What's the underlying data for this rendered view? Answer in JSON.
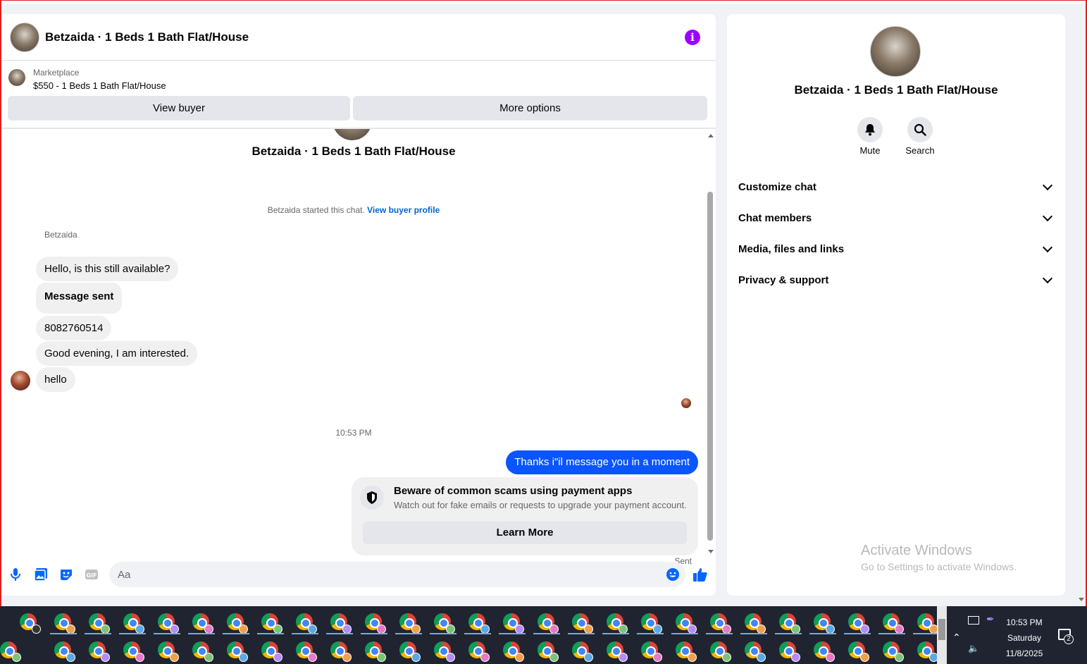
{
  "chat": {
    "header_title": "Betzaida · 1 Beds 1 Bath Flat/House",
    "marketplace_label": "Marketplace",
    "listing": "$550 - 1 Beds 1 Bath Flat/House",
    "view_buyer": "View buyer",
    "more_options": "More options",
    "thread_title": "Betzaida · 1 Beds 1 Bath Flat/House",
    "started_text": "Betzaida started this chat.",
    "view_buyer_profile": "View buyer profile",
    "sender_name": "Betzaida",
    "incoming": [
      "Hello, is this still available?",
      "Message sent",
      "8082760514",
      "Good evening, I am interested.",
      "hello"
    ],
    "timestamp": "10:53 PM",
    "outgoing": "Thanks i\"il message you in a moment",
    "scam_title": "Beware of common scams using payment apps",
    "scam_sub": "Watch out for fake emails or requests to upgrade your payment account.",
    "learn_more": "Learn More",
    "sent_status": "Sent",
    "composer_placeholder": "Aa"
  },
  "info_panel": {
    "title": "Betzaida · 1 Beds 1 Bath Flat/House",
    "actions": [
      "Mute",
      "Search"
    ],
    "sections": [
      "Customize chat",
      "Chat members",
      "Media, files and links",
      "Privacy & support"
    ]
  },
  "watermark": {
    "title": "Activate Windows",
    "subtitle": "Go to Settings to activate Windows."
  },
  "taskbar": {
    "time": "10:53 PM",
    "day": "Saturday",
    "date": "11/8/2025",
    "notification_count": "2"
  },
  "colors": {
    "accent": "#0a55ff",
    "info_icon": "#9b00ff",
    "link": "#0064d1"
  }
}
